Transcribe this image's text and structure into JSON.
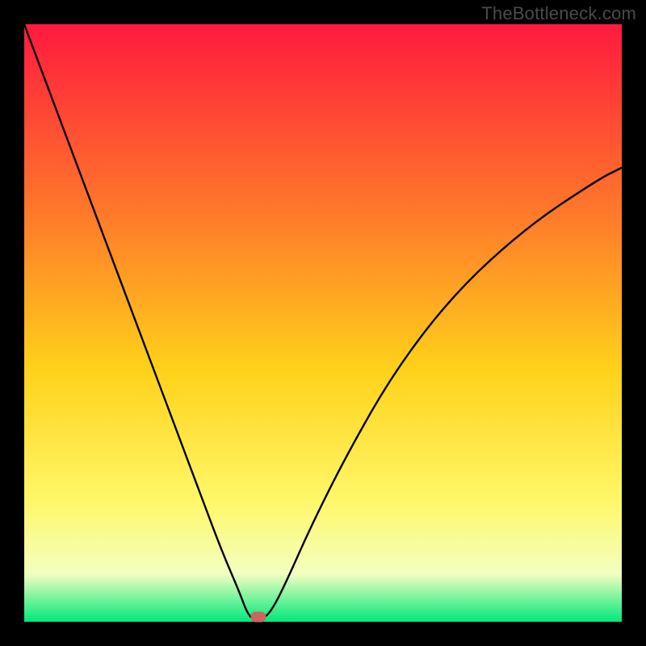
{
  "watermark": "TheBottleneck.com",
  "colors": {
    "frame_bg": "#000000",
    "grad_top": "#ff1a3e",
    "grad_mid1": "#ff7a2a",
    "grad_mid2": "#ffd21a",
    "grad_low1": "#fff86a",
    "grad_low2": "#f3ffc0",
    "grad_bottom": "#00e87c",
    "curve": "#000000",
    "marker": "#c96660",
    "watermark": "#4a4a4a"
  },
  "chart_data": {
    "type": "line",
    "title": "",
    "xlabel": "",
    "ylabel": "",
    "xlim": [
      0,
      100
    ],
    "ylim": [
      0,
      100
    ],
    "grid": false,
    "legend": false,
    "series": [
      {
        "name": "bottleneck-curve",
        "x": [
          0,
          3,
          6,
          9,
          12,
          15,
          18,
          21,
          24,
          27,
          30,
          33,
          36,
          37.5,
          38.8,
          40.0,
          41.5,
          44,
          48,
          54,
          62,
          72,
          84,
          96,
          100
        ],
        "values": [
          100,
          92,
          84,
          76,
          68,
          60,
          52,
          44,
          36,
          28,
          20,
          12,
          5,
          1,
          0.3,
          0.5,
          2,
          7,
          16,
          28,
          42,
          55,
          66,
          74,
          76
        ]
      }
    ],
    "marker": {
      "x": 39.2,
      "y": 0.8
    },
    "gradient_stops": [
      {
        "pct": 0,
        "color": "#ff1a3e"
      },
      {
        "pct": 32,
        "color": "#ff7a2a"
      },
      {
        "pct": 58,
        "color": "#ffd21a"
      },
      {
        "pct": 80,
        "color": "#fff86a"
      },
      {
        "pct": 92,
        "color": "#f3ffc0"
      },
      {
        "pct": 100,
        "color": "#00e87c"
      }
    ]
  }
}
